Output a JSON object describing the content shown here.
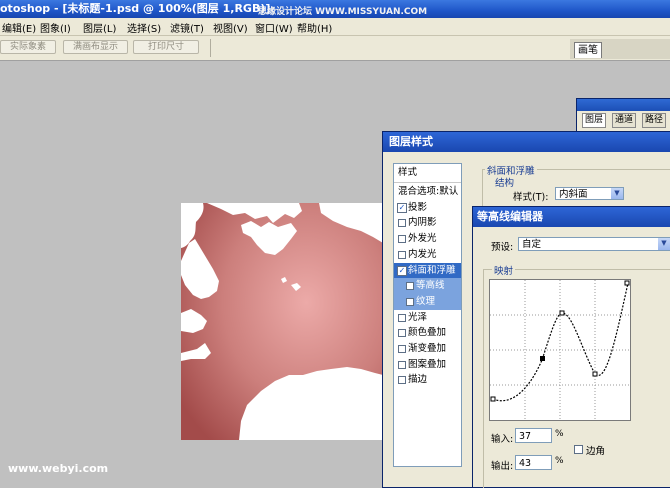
{
  "window": {
    "title": "otoshop - [未标题-1.psd @ 100%(图层 1,RGB)]",
    "watermark_top": "思缘设计论坛  WWW.MISSYUAN.COM"
  },
  "menu": [
    "编辑(E)",
    "图象(I)",
    "图层(L)",
    "选择(S)",
    "滤镜(T)",
    "视图(V)",
    "窗口(W)",
    "帮助(H)"
  ],
  "options_bar": {
    "buttons": [
      "实际象素",
      "满画布显示",
      "打印尺寸"
    ],
    "brush_tab": "画笔"
  },
  "layers_panel": {
    "tabs": [
      "图层",
      "通道",
      "路径"
    ]
  },
  "layer_style": {
    "title": "图层样式",
    "styles_header": "样式",
    "items": [
      {
        "label": "混合选项:默认",
        "checkbox": false,
        "checked": false,
        "state": "normal"
      },
      {
        "label": "投影",
        "checkbox": true,
        "checked": true,
        "state": "normal"
      },
      {
        "label": "内阴影",
        "checkbox": true,
        "checked": false,
        "state": "normal"
      },
      {
        "label": "外发光",
        "checkbox": true,
        "checked": false,
        "state": "normal"
      },
      {
        "label": "内发光",
        "checkbox": true,
        "checked": false,
        "state": "normal"
      },
      {
        "label": "斜面和浮雕",
        "checkbox": true,
        "checked": true,
        "state": "selected"
      },
      {
        "label": "等高线",
        "checkbox": true,
        "checked": false,
        "state": "sub"
      },
      {
        "label": "纹理",
        "checkbox": true,
        "checked": false,
        "state": "sub"
      },
      {
        "label": "光泽",
        "checkbox": true,
        "checked": false,
        "state": "normal"
      },
      {
        "label": "颜色叠加",
        "checkbox": true,
        "checked": false,
        "state": "normal"
      },
      {
        "label": "渐变叠加",
        "checkbox": true,
        "checked": false,
        "state": "normal"
      },
      {
        "label": "图案叠加",
        "checkbox": true,
        "checked": false,
        "state": "normal"
      },
      {
        "label": "描边",
        "checkbox": true,
        "checked": false,
        "state": "normal"
      }
    ],
    "bevel_group_label": "斜面和浮雕",
    "structure_label": "结构",
    "style_field_label": "样式(T):",
    "style_value": "内斜面"
  },
  "contour_editor": {
    "title": "等高线编辑器",
    "preset_label": "预设:",
    "preset_value": "自定",
    "mapping_label": "映射",
    "input_label": "输入:",
    "input_value": "37",
    "input_unit": "%",
    "output_label": "输出:",
    "output_value": "43",
    "output_unit": "%",
    "corner_label": "边角",
    "corner_checked": false
  },
  "watermark_bottom": "www.webyi.com",
  "colors": {
    "title_bar": "#1f56c8",
    "selected_item": "#316ac5",
    "canvas_red_light": "#e6a3a3",
    "canvas_red_dark": "#a54a4a"
  }
}
